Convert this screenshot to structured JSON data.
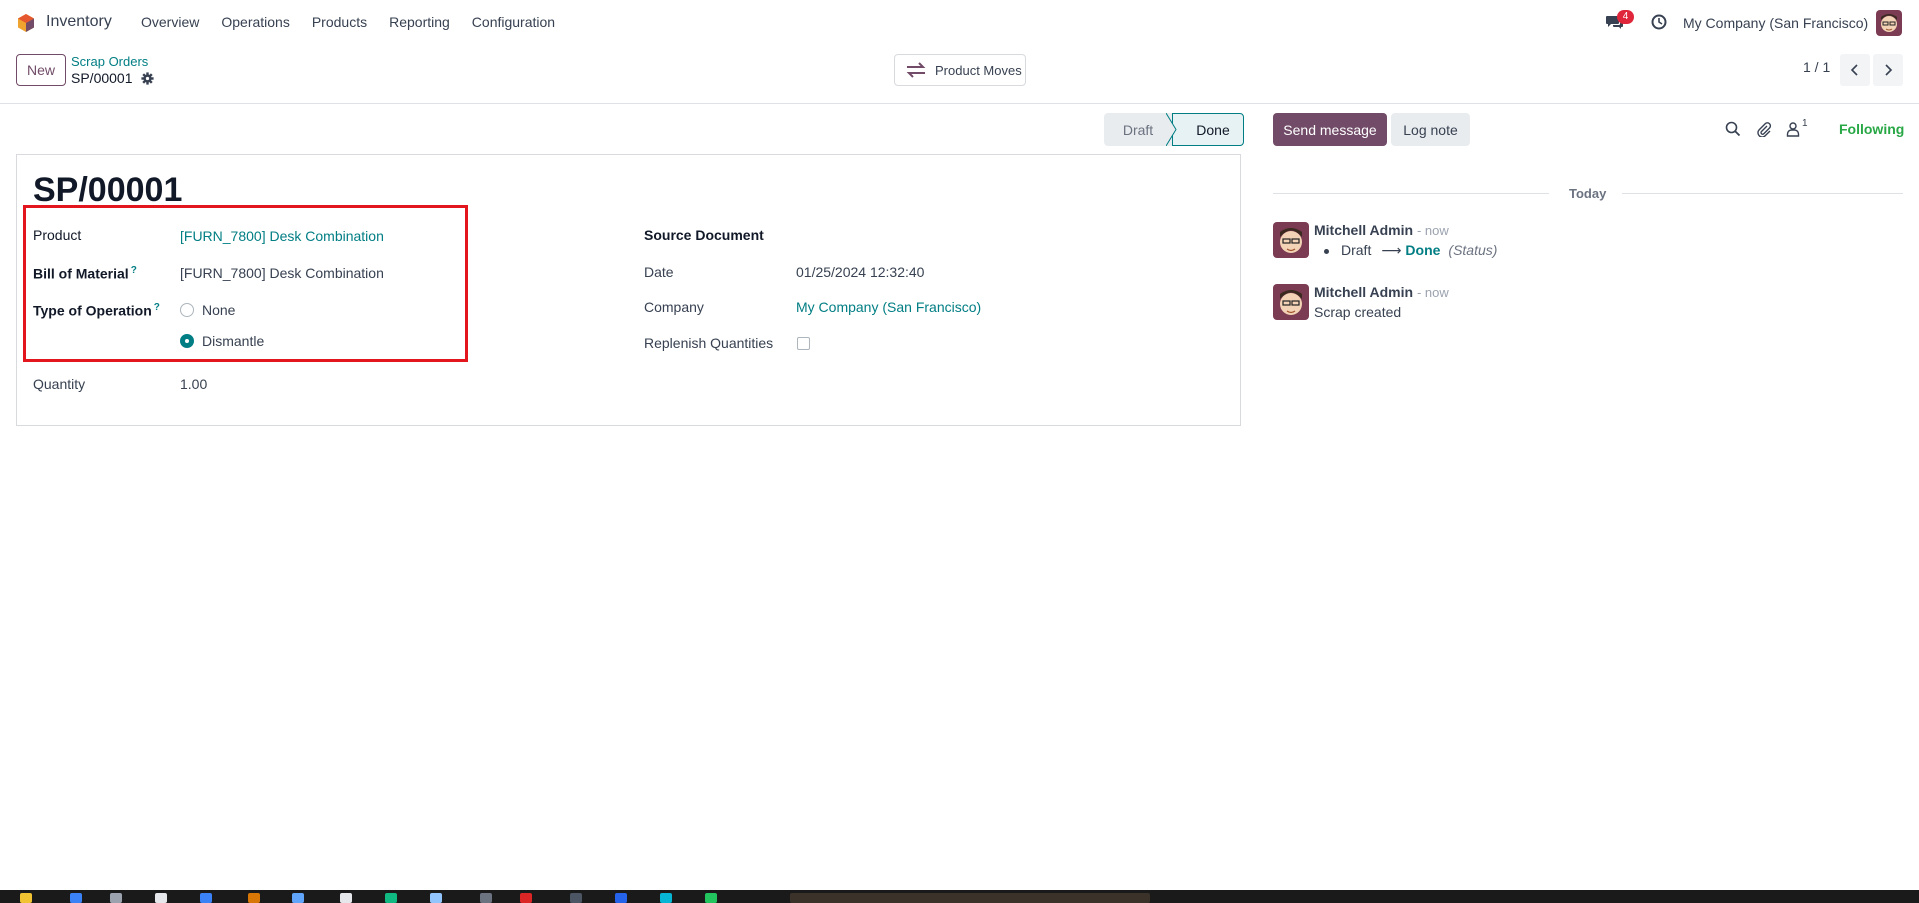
{
  "topnav": {
    "app_name": "Inventory",
    "menu": [
      "Overview",
      "Operations",
      "Products",
      "Reporting",
      "Configuration"
    ],
    "chat_badge": "4",
    "company": "My Company (San Francisco)"
  },
  "control": {
    "new_label": "New",
    "breadcrumb_parent": "Scrap Orders",
    "breadcrumb_current": "SP/00001",
    "product_moves_label": "Product Moves",
    "pager": "1 / 1"
  },
  "status": {
    "steps": [
      "Draft",
      "Done"
    ],
    "current": "Done"
  },
  "form": {
    "title": "SP/00001",
    "product_label": "Product",
    "product_value": "[FURN_7800] Desk Combination",
    "bom_label": "Bill of Material",
    "bom_value": "[FURN_7800] Desk Combination",
    "type_label": "Type of Operation",
    "type_options": [
      "None",
      "Dismantle"
    ],
    "type_selected": "Dismantle",
    "quantity_label": "Quantity",
    "quantity_value": "1.00",
    "source_label": "Source Document",
    "source_value": "",
    "date_label": "Date",
    "date_value": "01/25/2024 12:32:40",
    "company_label": "Company",
    "company_value": "My Company (San Francisco)",
    "replenish_label": "Replenish Quantities",
    "replenish_checked": false,
    "help_mark": "?"
  },
  "chatter": {
    "send_label": "Send message",
    "log_label": "Log note",
    "follower_count": "1",
    "following_label": "Following",
    "date_separator": "Today",
    "messages": [
      {
        "author": "Mitchell Admin",
        "when": "- now",
        "old_value": "Draft",
        "new_value": "Done",
        "field": "(Status)"
      },
      {
        "author": "Mitchell Admin",
        "when": "- now",
        "body": "Scrap created"
      }
    ]
  },
  "colors": {
    "brand": "#714b67",
    "link": "#017e84",
    "highlight": "#e3161e",
    "following": "#28a745"
  }
}
